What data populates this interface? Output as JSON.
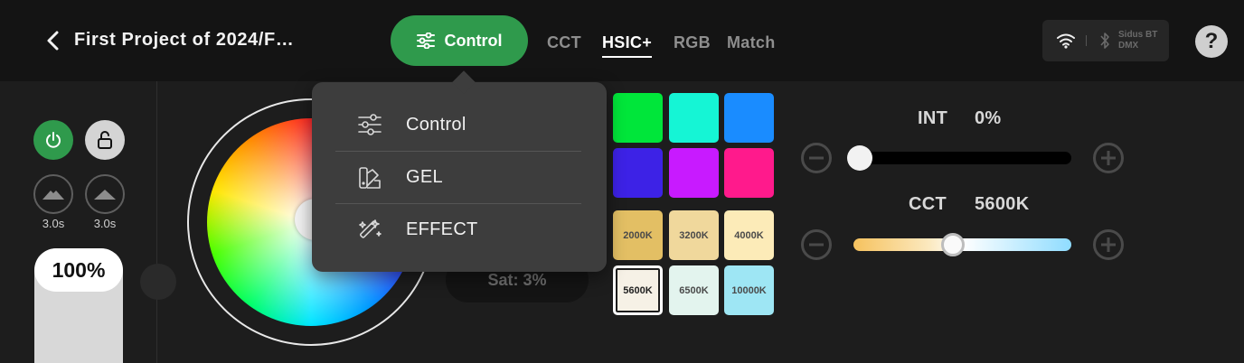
{
  "header": {
    "back_icon": "chevron-left-icon",
    "project_title": "First Project of 2024/F…",
    "control_button": {
      "label": "Control",
      "icon": "sliders-icon",
      "color": "#2f9a4c"
    },
    "tabs": [
      {
        "label": "CCT",
        "active": false
      },
      {
        "label": "HSIC+",
        "active": true
      },
      {
        "label": "RGB",
        "active": false
      },
      {
        "label": "Match",
        "active": false
      }
    ],
    "connection": {
      "wifi_icon": "wifi-icon",
      "bluetooth_icon": "bluetooth-icon",
      "line1": "Sidus BT",
      "line2": "DMX"
    },
    "help_label": "?"
  },
  "left_panel": {
    "power_icon": "power-icon",
    "lock_icon": "unlock-icon",
    "fade_in_time": "3.0s",
    "fade_out_time": "3.0s",
    "brightness": "100%",
    "brightness_level": 1.0
  },
  "color_wheel": {
    "saturation_label": "Sat: 3%"
  },
  "swatches": {
    "colors": [
      "#00e63a",
      "#15f5d5",
      "#1a8cff",
      "#3d22e6",
      "#c81aff",
      "#ff1a8c"
    ],
    "cct": [
      {
        "label": "2000K",
        "color": "#e3bf64",
        "selected": false
      },
      {
        "label": "3200K",
        "color": "#f0d89c",
        "selected": false
      },
      {
        "label": "4000K",
        "color": "#fcebb8",
        "selected": false
      },
      {
        "label": "5600K",
        "color": "#f6f1e6",
        "selected": true
      },
      {
        "label": "6500K",
        "color": "#e3f4ee",
        "selected": false
      },
      {
        "label": "10000K",
        "color": "#9ee6f4",
        "selected": false
      }
    ]
  },
  "params": {
    "int": {
      "label": "INT",
      "value": "0%",
      "level": 0.0
    },
    "cct": {
      "label": "CCT",
      "value": "5600K",
      "level": 0.45
    }
  },
  "dropdown": {
    "items": [
      {
        "label": "Control",
        "icon": "sliders-icon"
      },
      {
        "label": "GEL",
        "icon": "gel-swatch-icon"
      },
      {
        "label": "EFFECT",
        "icon": "magic-wand-icon"
      }
    ]
  }
}
